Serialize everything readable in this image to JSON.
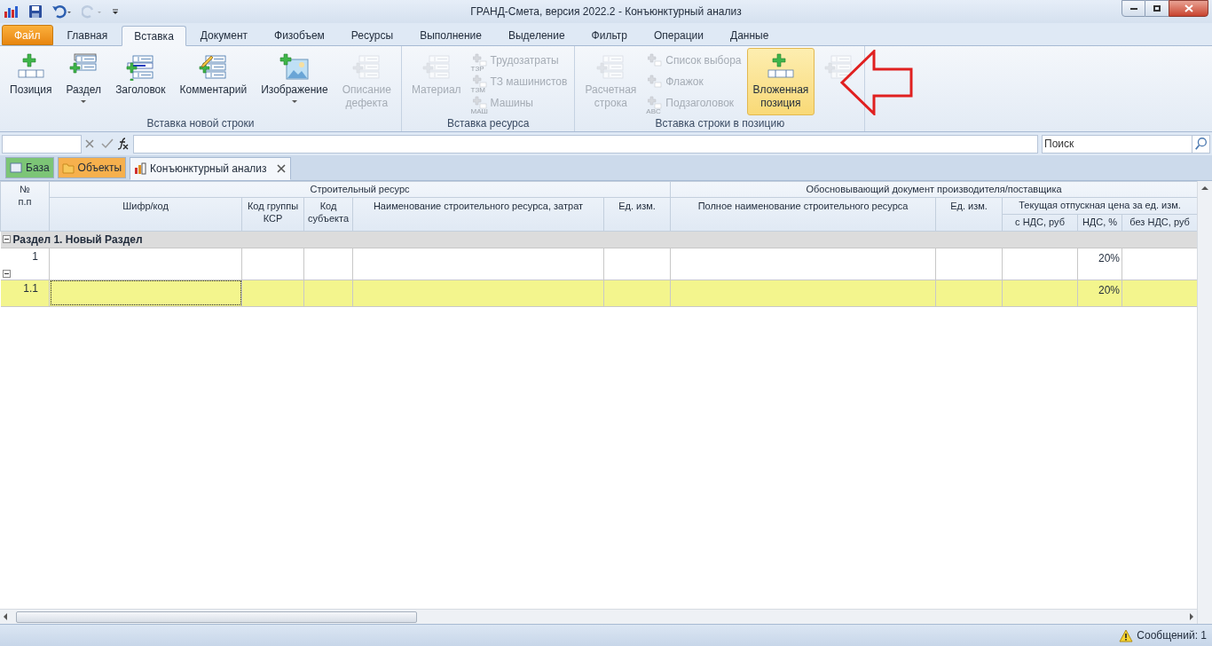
{
  "window": {
    "title": "ГРАНД-Смета, версия 2022.2 - Конъюнктурный анализ"
  },
  "ribbon": {
    "tabs": [
      {
        "label": "Файл",
        "kind": "file",
        "selected": false
      },
      {
        "label": "Главная",
        "kind": "tab",
        "selected": false
      },
      {
        "label": "Вставка",
        "kind": "tab",
        "selected": true
      },
      {
        "label": "Документ",
        "kind": "tab",
        "selected": false
      },
      {
        "label": "Физобъем",
        "kind": "tab",
        "selected": false
      },
      {
        "label": "Ресурсы",
        "kind": "tab",
        "selected": false
      },
      {
        "label": "Выполнение",
        "kind": "tab",
        "selected": false
      },
      {
        "label": "Выделение",
        "kind": "tab",
        "selected": false
      },
      {
        "label": "Фильтр",
        "kind": "tab",
        "selected": false
      },
      {
        "label": "Операции",
        "kind": "tab",
        "selected": false
      },
      {
        "label": "Данные",
        "kind": "tab",
        "selected": false
      }
    ],
    "groups": [
      {
        "title": "Вставка новой строки",
        "items": [
          {
            "kind": "large",
            "label": "Позиция",
            "disabled": false,
            "dropdown": false,
            "highlighted": false
          },
          {
            "kind": "large",
            "label": "Раздел",
            "disabled": false,
            "dropdown": true,
            "highlighted": false
          },
          {
            "kind": "large",
            "label": "Заголовок",
            "disabled": false,
            "dropdown": false,
            "highlighted": false
          },
          {
            "kind": "large",
            "label": "Комментарий",
            "disabled": false,
            "dropdown": false,
            "highlighted": false
          },
          {
            "kind": "large",
            "label": "Изображение",
            "disabled": false,
            "dropdown": true,
            "highlighted": false
          },
          {
            "kind": "large",
            "label": "Описание\nдефекта",
            "disabled": true,
            "dropdown": false,
            "highlighted": false
          }
        ]
      },
      {
        "title": "Вставка ресурса",
        "items": [
          {
            "kind": "large",
            "label": "Материал",
            "disabled": true,
            "dropdown": false,
            "highlighted": false
          },
          {
            "kind": "stack",
            "entries": [
              {
                "label": "Трудозатраты",
                "badge": "ТЗР",
                "disabled": true
              },
              {
                "label": "ТЗ машинистов",
                "badge": "ТЗМ",
                "disabled": true
              },
              {
                "label": "Машины",
                "badge": "МАШ",
                "disabled": true
              }
            ]
          }
        ]
      },
      {
        "title": "Вставка строки в позицию",
        "items": [
          {
            "kind": "large",
            "label": "Расчетная\nстрока",
            "disabled": true,
            "dropdown": false,
            "highlighted": false
          },
          {
            "kind": "stack",
            "entries": [
              {
                "label": "Список выбора",
                "disabled": true
              },
              {
                "label": "Флажок",
                "disabled": true
              },
              {
                "label": "Подзаголовок",
                "badge": "ABC",
                "disabled": true
              }
            ]
          },
          {
            "kind": "large",
            "label": "Вложенная\nпозиция",
            "disabled": false,
            "dropdown": false,
            "highlighted": true
          },
          {
            "kind": "large",
            "disabled": true,
            "dropdown": false,
            "highlighted": false
          }
        ]
      }
    ]
  },
  "search": {
    "placeholder": "Поиск"
  },
  "doc_tabs": [
    {
      "label": "База",
      "color": "#7cc576",
      "closable": false,
      "selected": false
    },
    {
      "label": "Объекты",
      "color": "#f6b04d",
      "closable": false,
      "selected": false
    },
    {
      "label": "Конъюнктурный анализ",
      "color": "#f4f7fb",
      "closable": true,
      "selected": true
    }
  ],
  "table": {
    "number_header": "№\nп.п",
    "groups": [
      {
        "title": "Строительный ресурс",
        "columns": [
          {
            "label": "Шифр/код"
          },
          {
            "label": "Код группы КСР"
          },
          {
            "label": "Код субъекта"
          },
          {
            "label": "Наименование строительного ресурса, затрат"
          },
          {
            "label": "Ед. изм."
          }
        ]
      },
      {
        "title": "Обосновывающий документ производителя/поставщика",
        "columns": [
          {
            "label": "Полное наименование строительного ресурса"
          },
          {
            "label": "Ед. изм."
          },
          {
            "label": "Текущая отпускная цена за ед. изм.",
            "children": [
              {
                "label": "с НДС, руб"
              },
              {
                "label": "НДС, %"
              },
              {
                "label": "без НДС, руб"
              }
            ]
          }
        ]
      }
    ],
    "rows": [
      {
        "kind": "section",
        "label": "Раздел 1. Новый Раздел",
        "expanded": true,
        "selected": false
      },
      {
        "kind": "position",
        "number": "1",
        "vat": "20%",
        "expanded": true,
        "selected": false
      },
      {
        "kind": "position",
        "number": "1.1",
        "vat": "20%",
        "selected": true
      }
    ]
  },
  "status_bar": {
    "messages": "Сообщений: 1"
  }
}
